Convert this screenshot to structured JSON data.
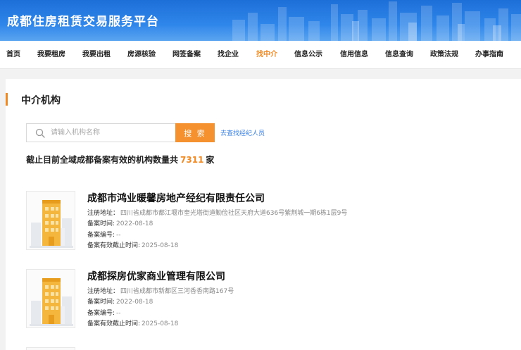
{
  "header": {
    "title": "成都住房租赁交易服务平台"
  },
  "nav": {
    "items": [
      "首页",
      "我要租房",
      "我要出租",
      "房源核验",
      "网签备案",
      "找企业",
      "找中介",
      "信息公示",
      "信用信息",
      "信息查询",
      "政策法规",
      "办事指南"
    ],
    "active_index": 6
  },
  "section": {
    "title": "中介机构"
  },
  "search": {
    "placeholder": "请输入机构名称",
    "button_label": "搜 索",
    "agent_link": "去查找经纪人员"
  },
  "summary": {
    "prefix": "截止目前全域成都备案有效的机构数量共",
    "count": "7311",
    "suffix": "家"
  },
  "organizations": [
    {
      "name": "成都市鸿业暖馨房地产经纪有限责任公司",
      "address_label": "注册地址：",
      "address": "四川省成都市都江堰市奎光塔街道勤俭社区天府大道636号紫荆城一期6栋1层9号",
      "record_time_label": "备案时间:",
      "record_time": "2022-08-18",
      "record_no_label": "备案编号:",
      "record_no": "--",
      "expiry_label": "备案有效截止时间:",
      "expiry": "2025-08-18"
    },
    {
      "name": "成都探房优家商业管理有限公司",
      "address_label": "注册地址：",
      "address": "四川省成都市新都区三河香香南路167号",
      "record_time_label": "备案时间:",
      "record_time": "2022-08-18",
      "record_no_label": "备案编号:",
      "record_no": "--",
      "expiry_label": "备案有效截止时间:",
      "expiry": "2025-08-18"
    }
  ],
  "colors": {
    "accent": "#f08a24",
    "brand_blue": "#1d6fd8",
    "link": "#3b82e6"
  },
  "icons": {
    "search": "search-icon",
    "building": "building-icon"
  }
}
